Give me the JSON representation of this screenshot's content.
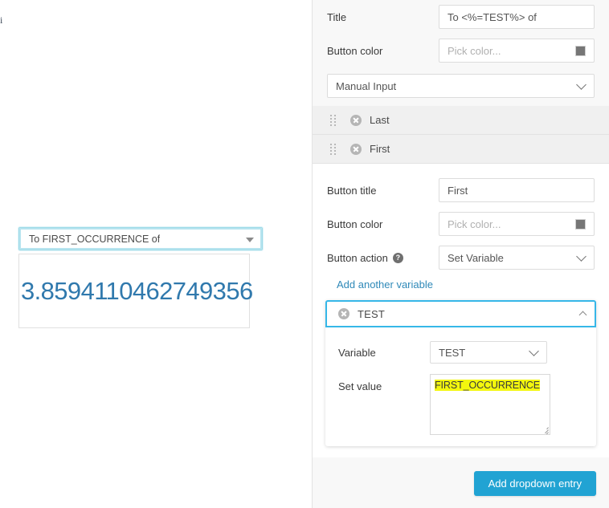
{
  "preview": {
    "dropdown_label": "To FIRST_OCCURRENCE of",
    "caret_icon": "caret-down-icon",
    "result_value": "3.8594110462749356",
    "edge_glyph": "i",
    "accent_border": "#9fdbe8",
    "result_color": "#3079ad"
  },
  "form": {
    "title": {
      "label": "Title",
      "value": "To <%=TEST%> of"
    },
    "button_color": {
      "label": "Button color",
      "placeholder": "Pick color...",
      "swatch_color": "#767676",
      "swatch_icon": "color-swatch-icon"
    },
    "source": {
      "selected": "Manual Input",
      "chevron_icon": "chevron-down-icon"
    },
    "entries": [
      {
        "label": "Last",
        "drag_icon": "drag-handle-icon",
        "remove_icon": "remove-circle-icon"
      },
      {
        "label": "First",
        "drag_icon": "drag-handle-icon",
        "remove_icon": "remove-circle-icon"
      }
    ],
    "entry_detail": {
      "button_title": {
        "label": "Button title",
        "value": "First"
      },
      "button_color": {
        "label": "Button color",
        "placeholder": "Pick color...",
        "swatch_color": "#767676",
        "swatch_icon": "color-swatch-icon"
      },
      "button_action": {
        "label": "Button action",
        "help_icon": "help-circle-icon",
        "help_glyph": "?",
        "selected": "Set Variable",
        "chevron_icon": "chevron-down-icon"
      },
      "add_variable_link": "Add another variable"
    },
    "variable_card": {
      "header_title": "TEST",
      "remove_icon": "remove-circle-icon",
      "collapse_icon": "chevron-up-icon",
      "focus_color": "#36b7e8",
      "variable": {
        "label": "Variable",
        "selected": "TEST",
        "chevron_icon": "chevron-down-icon"
      },
      "set_value": {
        "label": "Set value",
        "value": "FIRST_OCCURRENCE",
        "highlight_color": "#f3f70e",
        "resize_icon": "resize-grip-icon"
      }
    },
    "footer": {
      "add_entry_label": "Add dropdown entry",
      "button_color": "#21a3d3"
    }
  }
}
